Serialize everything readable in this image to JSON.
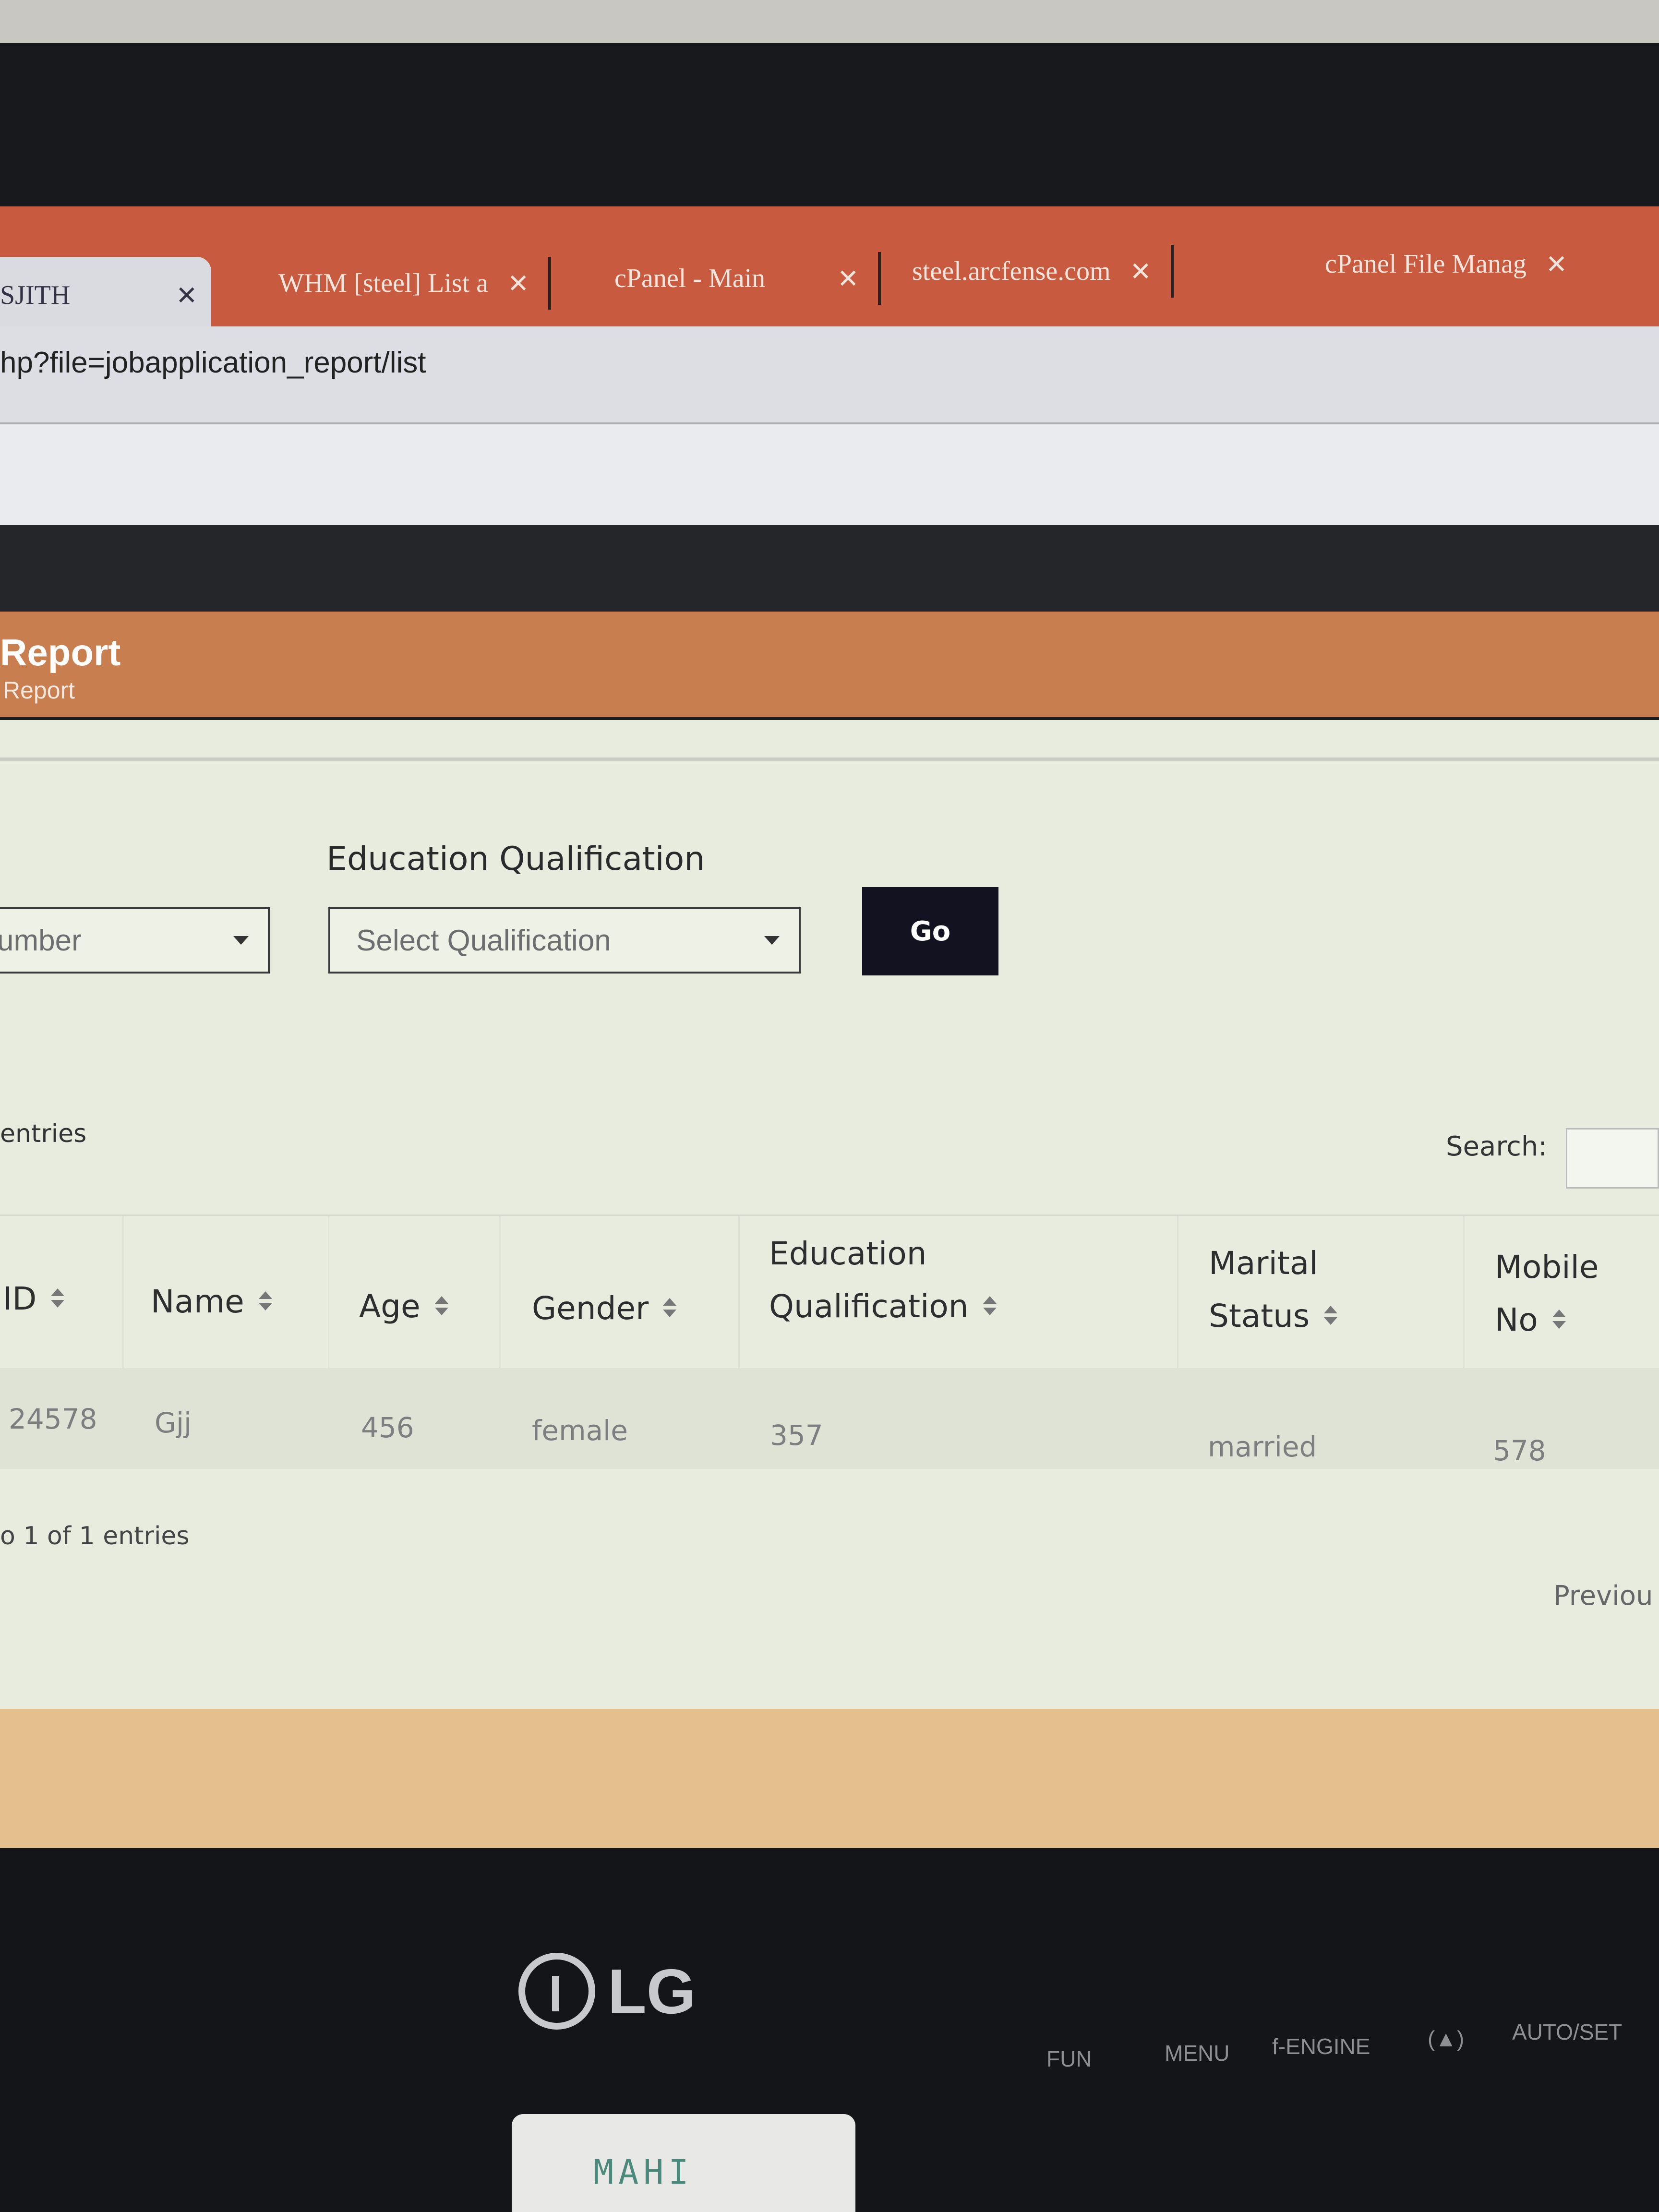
{
  "browser": {
    "tabs": [
      {
        "label": "SJITH",
        "close": "✕",
        "active": true
      },
      {
        "label": "WHM [steel] List a",
        "close": "✕"
      },
      {
        "label": "cPanel - Main",
        "close": "✕"
      },
      {
        "label": "steel.arcfense.com",
        "close": "✕"
      },
      {
        "label": "cPanel File Manag",
        "close": "✕"
      }
    ],
    "url": "hp?file=jobapplication_report/list"
  },
  "page": {
    "title": "Report",
    "breadcrumb": "Report"
  },
  "filters": {
    "qualification_label": "Education Qualification",
    "number_select_value": "umber",
    "qualification_select_value": "Select Qualification",
    "go_label": "Go"
  },
  "table_controls": {
    "entries_label": "entries",
    "search_label": "Search:"
  },
  "table": {
    "headers": {
      "id": "ID",
      "name": "Name",
      "age": "Age",
      "gender": "Gender",
      "education_line1": "Education",
      "education_line2": "Qualification",
      "marital_line1": "Marital",
      "marital_line2": "Status",
      "mobile_line1": "Mobile",
      "mobile_line2": "No"
    },
    "rows": [
      {
        "id": "24578",
        "name": "Gjj",
        "age": "456",
        "gender": "female",
        "education": "357",
        "marital": "married",
        "mobile": "578"
      }
    ]
  },
  "footer": {
    "info": "o 1 of 1 entries",
    "previous": "Previou"
  },
  "monitor": {
    "brand": "LG",
    "controls": [
      "FUN",
      "MENU",
      "f-ENGINE",
      "(▲)",
      "AUTO/SET"
    ],
    "sticker": "MAHI"
  }
}
